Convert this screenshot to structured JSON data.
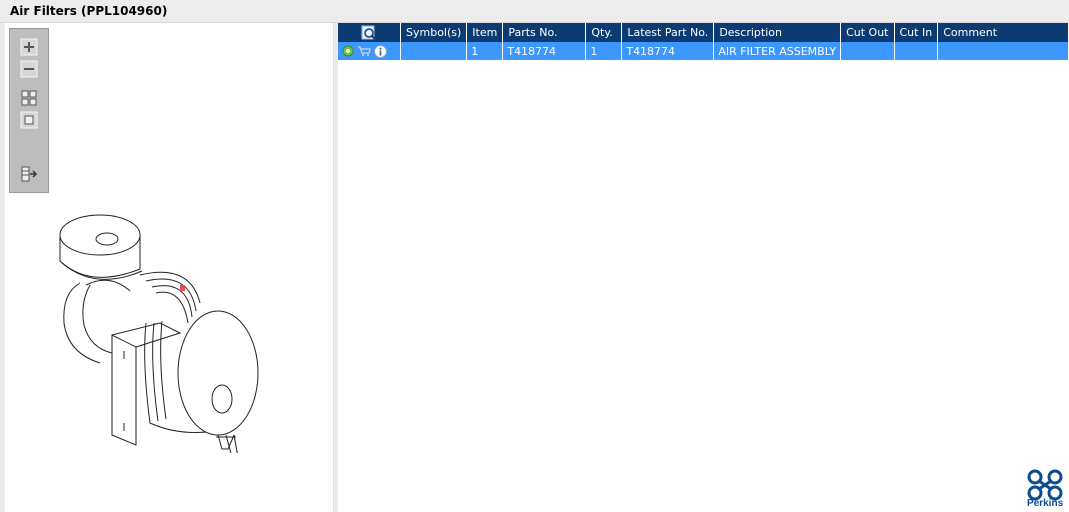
{
  "window": {
    "title": "Air Filters (PPL104960)"
  },
  "grid": {
    "columns": [
      "",
      "Symbol(s)",
      "Item",
      "Parts No.",
      "Qty.",
      "Latest Part No.",
      "Description",
      "Cut Out",
      "Cut In",
      "Comment"
    ],
    "rows": [
      {
        "symbols": "",
        "item": "1",
        "parts_no": "T418774",
        "qty": "1",
        "latest_part_no": "T418774",
        "description": "AIR FILTER ASSEMBLY",
        "cut_out": "",
        "cut_in": "",
        "comment": ""
      }
    ]
  },
  "brand": {
    "name": "Perkins",
    "color": "#0c4c8f"
  },
  "colors": {
    "header_bg": "#0c3b73",
    "selected_row": "#3c97ff"
  }
}
